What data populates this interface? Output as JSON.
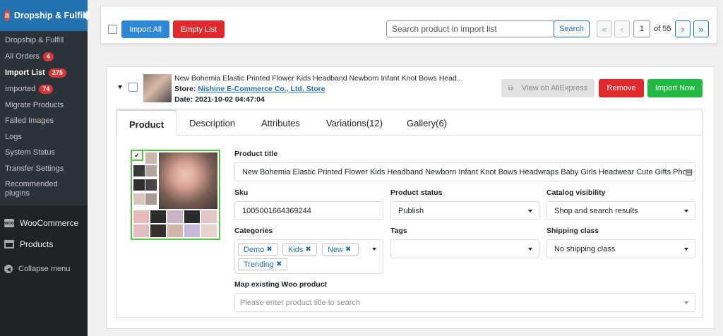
{
  "sidebar": {
    "plugin_title": "Dropship & Fulfill",
    "logo_letter": "a",
    "items": [
      {
        "label": "Dropship & Fulfill",
        "badge": ""
      },
      {
        "label": "Ali Orders",
        "badge": "4"
      },
      {
        "label": "Import List",
        "badge": "275"
      },
      {
        "label": "Imported",
        "badge": "74"
      },
      {
        "label": "Migrate Products",
        "badge": ""
      },
      {
        "label": "Failed Images",
        "badge": ""
      },
      {
        "label": "Logs",
        "badge": ""
      },
      {
        "label": "System Status",
        "badge": ""
      },
      {
        "label": "Transfer Settings",
        "badge": ""
      },
      {
        "label": "Recommended plugins",
        "badge": ""
      }
    ],
    "woocommerce": "WooCommerce",
    "woo_icon_text": "woo",
    "products": "Products",
    "collapse": "Collapse menu"
  },
  "toolbar": {
    "import_all": "Import All",
    "empty_list": "Empty List",
    "search_placeholder": "Search product in import list",
    "search_button": "Search",
    "first": "«",
    "prev": "‹",
    "page": "1",
    "of": "of 55",
    "next": "›",
    "last": "»"
  },
  "product": {
    "title_short": "New Bohemia Elastic Printed Flower Kids Headband Newborn Infant Knot Bows Head...",
    "store_label": "Store:",
    "store_name": "Nishine E-Commerce Co., Ltd. Store",
    "date_label": "Date:",
    "date": "2021-10-02 04:47:04",
    "view_btn": "View on AliExpress",
    "remove_btn": "Remove",
    "import_btn": "Import Now"
  },
  "tabs": [
    "Product",
    "Description",
    "Attributes",
    "Variations(12)",
    "Gallery(6)"
  ],
  "form": {
    "product_title_label": "Product title",
    "product_title_value": "New Bohemia Elastic Printed Flower Kids Headband Newborn Infant Knot Bows Headwraps Baby Girls Headwear Cute Gifts Photo Props",
    "sku_label": "Sku",
    "sku_value": "1005001664369244",
    "status_label": "Product status",
    "status_value": "Publish",
    "visibility_label": "Catalog visibility",
    "visibility_value": "Shop and search results",
    "categories_label": "Categories",
    "categories": [
      "Demo",
      "Kids",
      "New",
      "Trending"
    ],
    "tags_label": "Tags",
    "shipping_label": "Shipping class",
    "shipping_value": "No shipping class",
    "map_label": "Map existing Woo product",
    "map_placeholder": "Please enter product title to search"
  },
  "colors": {
    "wp_blue": "#2271b1",
    "btn_blue": "#2d86d6",
    "btn_red": "#e0282d",
    "btn_green": "#21ba45",
    "gallery_border": "#5bbd4b",
    "sidebar_bg": "#1d2327"
  }
}
